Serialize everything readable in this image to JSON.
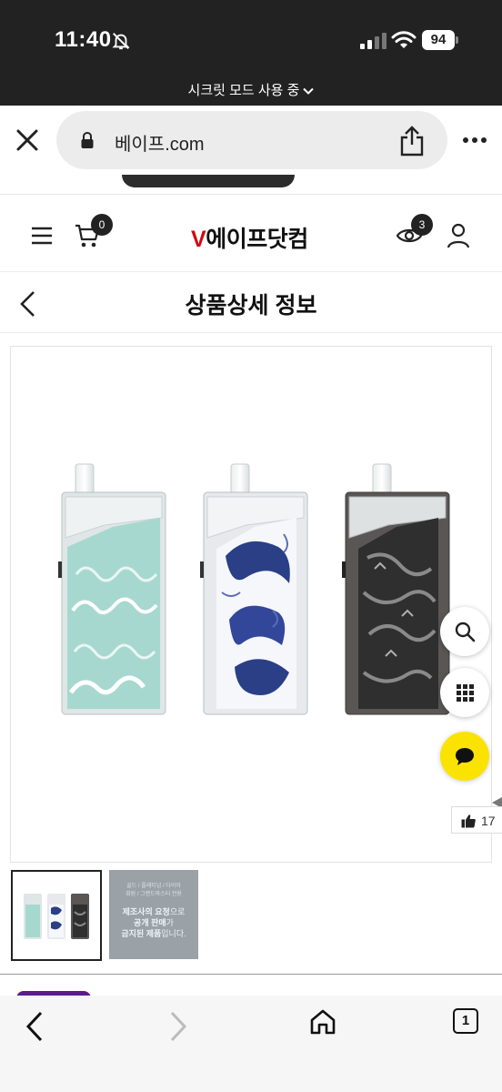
{
  "status_bar": {
    "time": "11:40",
    "battery": "94",
    "icons": [
      "bell-slash-icon",
      "signal-icon",
      "wifi-icon",
      "battery-icon"
    ]
  },
  "private_mode": {
    "label": "시크릿 모드 사용 중",
    "icon": "chevron-down-icon"
  },
  "browser": {
    "url": "베이프.com",
    "icons": [
      "close-icon",
      "lock-icon",
      "share-icon",
      "more-icon"
    ]
  },
  "header": {
    "logo_v": "V",
    "logo_rest": "에이프닷컴",
    "cart_count": "0",
    "recent_count": "3",
    "icons": [
      "menu-icon",
      "cart-icon",
      "eye-icon",
      "user-icon"
    ]
  },
  "page": {
    "title": "상품상세 정보",
    "icons": [
      "chevron-left-icon"
    ]
  },
  "floating": {
    "like_count": "17",
    "icons": [
      "search-icon",
      "grid-icon",
      "chat-icon",
      "thumbs-up-icon"
    ]
  },
  "thumbnail_notice": {
    "small_line1": "골드 / 플래티넘 / 다이아",
    "small_line2": "회원 / 그랜드마스터 전용",
    "bold1": "제조사의 요청",
    "normal1": "으로",
    "bold2": "공개 판매",
    "normal2": "가",
    "bold3": "금지된 제품",
    "normal3": "입니다."
  },
  "toolbar": {
    "tab_count": "1",
    "icons": [
      "back-icon",
      "forward-icon",
      "home-icon",
      "tabs-icon"
    ]
  },
  "colors": {
    "status_bg": "#222222",
    "logo_accent": "#d20a11",
    "chat_button": "#fbe300",
    "teal_device": "#a7d8cf",
    "navy_koi": "#2a3f86",
    "dark_device": "#3c3c3c"
  }
}
